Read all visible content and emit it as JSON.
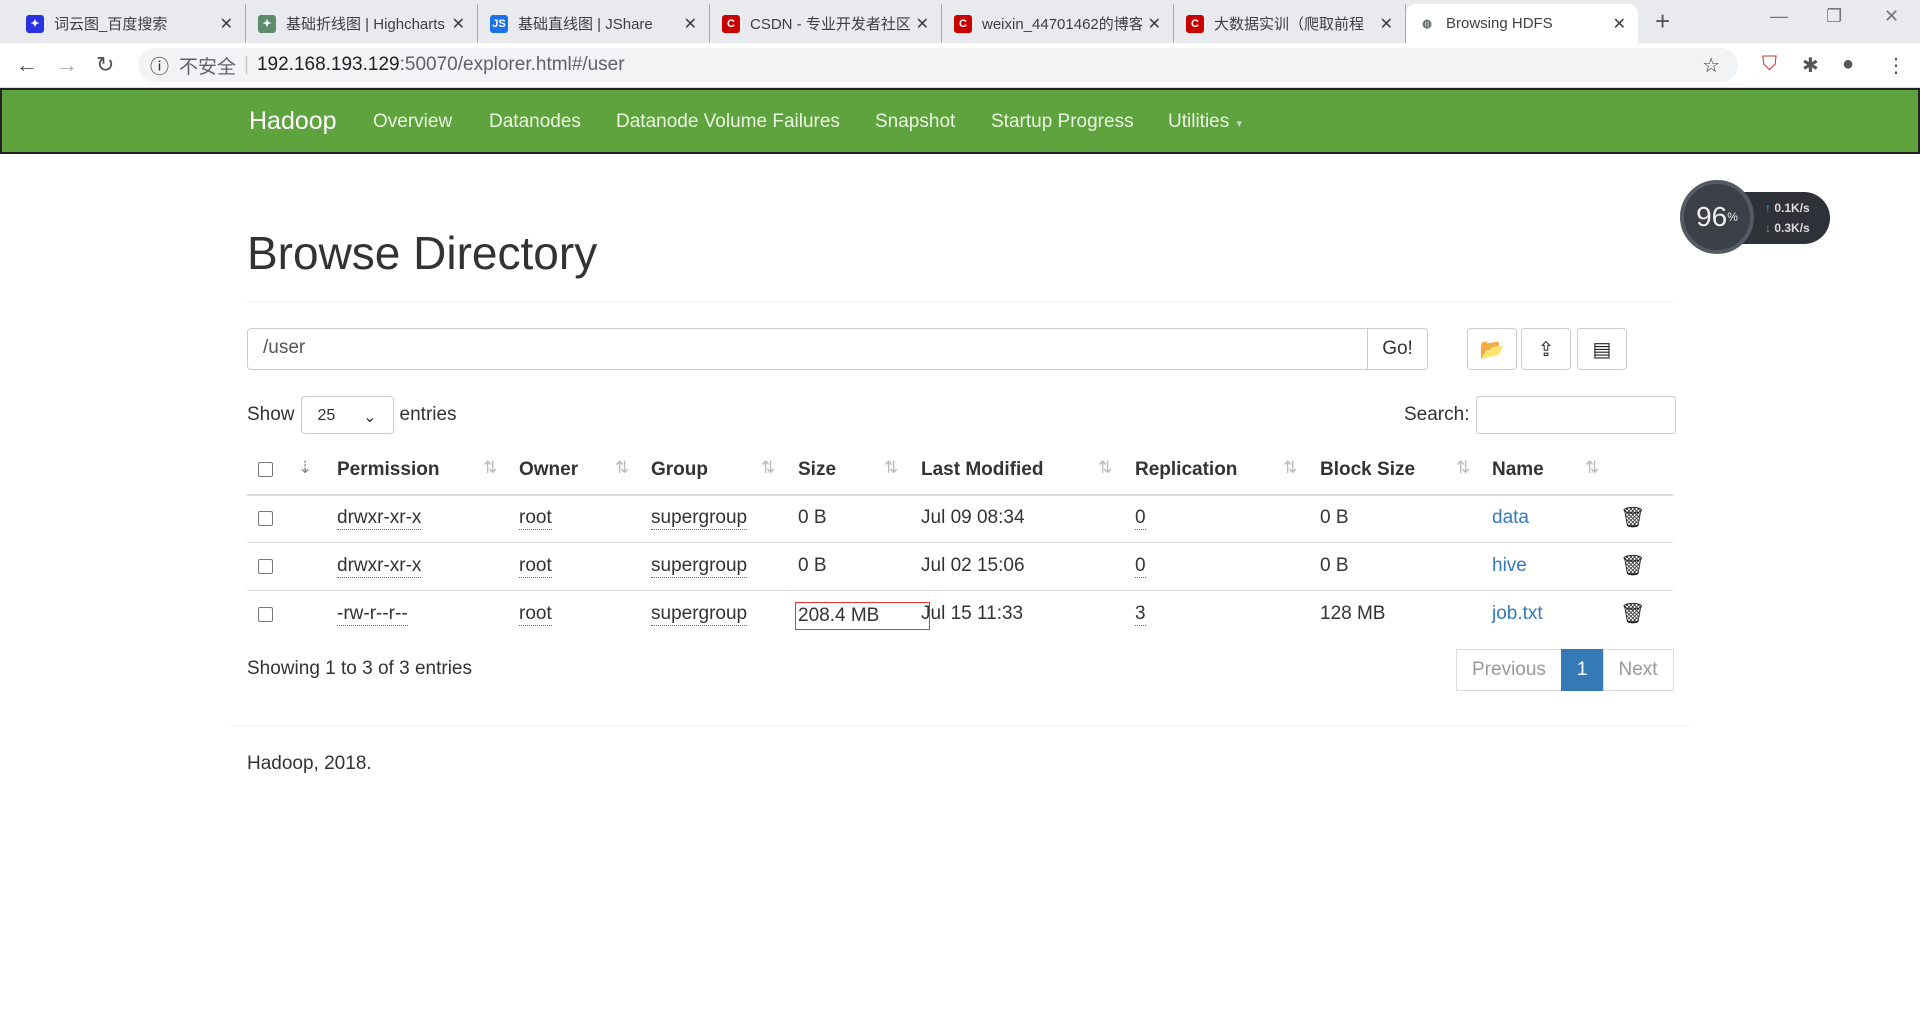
{
  "browser": {
    "tabs": [
      {
        "title": "词云图_百度搜索",
        "icon": "baidu-paw-icon",
        "color": "#2932e1"
      },
      {
        "title": "基础折线图 | Highcharts",
        "icon": "highcharts-icon",
        "color": "#5b8c6e"
      },
      {
        "title": "基础直线图 | JShare",
        "icon": "jshare-icon",
        "color": "#1a73e8"
      },
      {
        "title": "CSDN - 专业开发者社区",
        "icon": "csdn-icon",
        "color": "#c90000"
      },
      {
        "title": "weixin_44701462的博客",
        "icon": "csdn-icon",
        "color": "#c90000"
      },
      {
        "title": "大数据实训（爬取前程",
        "icon": "csdn-icon",
        "color": "#c90000"
      },
      {
        "title": "Browsing HDFS",
        "icon": "globe-icon",
        "color": "#5f6368"
      }
    ],
    "insecure_label": "不安全",
    "url_host": "192.168.193.129",
    "url_path": ":50070/explorer.html#/user"
  },
  "navbar": {
    "brand": "Hadoop",
    "items": [
      "Overview",
      "Datanodes",
      "Datanode Volume Failures",
      "Snapshot",
      "Startup Progress",
      "Utilities"
    ],
    "color": "#5fa33e"
  },
  "widget": {
    "percent": "96",
    "percent_sign": "%",
    "up": "0.1K/s",
    "down": "0.3K/s"
  },
  "page": {
    "title": "Browse Directory",
    "path_value": "/user",
    "go_label": "Go!",
    "show_label": "Show",
    "entries_label": "entries",
    "page_size": "25",
    "search_label": "Search:",
    "columns": [
      "Permission",
      "Owner",
      "Group",
      "Size",
      "Last Modified",
      "Replication",
      "Block Size",
      "Name"
    ],
    "rows": [
      {
        "permission": "drwxr-xr-x",
        "owner": "root",
        "group": "supergroup",
        "size": "0 B",
        "modified": "Jul 09 08:34",
        "replication": "0",
        "block_size": "0 B",
        "name": "data"
      },
      {
        "permission": "drwxr-xr-x",
        "owner": "root",
        "group": "supergroup",
        "size": "0 B",
        "modified": "Jul 02 15:06",
        "replication": "0",
        "block_size": "0 B",
        "name": "hive"
      },
      {
        "permission": "-rw-r--r--",
        "owner": "root",
        "group": "supergroup",
        "size": "208.4 MB",
        "modified": "Jul 15 11:33",
        "replication": "3",
        "block_size": "128 MB",
        "name": "job.txt"
      }
    ],
    "info": "Showing 1 to 3 of 3 entries",
    "pager": {
      "previous": "Previous",
      "current": "1",
      "next": "Next"
    },
    "footer": "Hadoop, 2018."
  }
}
